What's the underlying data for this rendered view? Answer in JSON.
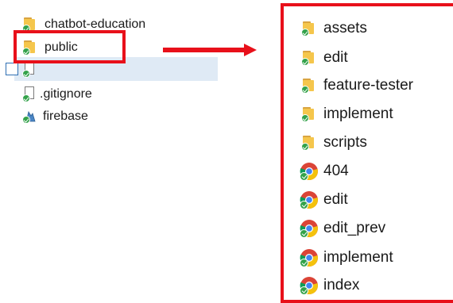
{
  "colors": {
    "highlight": "#e8101a",
    "selection": "#dfeaf5",
    "sync_ok": "#33a24a",
    "folder": "#f5c64c"
  },
  "left_tree": {
    "items": [
      {
        "label": "chatbot-education",
        "icon": "folder-synced-icon"
      },
      {
        "label": "public",
        "icon": "folder-synced-icon"
      },
      {
        "label": "",
        "icon": "file-synced-icon"
      },
      {
        "label": ".gitignore",
        "icon": "file-synced-icon"
      },
      {
        "label": "firebase",
        "icon": "firebase-synced-icon"
      }
    ]
  },
  "public_contents": {
    "items": [
      {
        "label": "assets",
        "icon": "folder-synced-icon"
      },
      {
        "label": "edit",
        "icon": "folder-synced-icon"
      },
      {
        "label": "feature-tester",
        "icon": "folder-synced-icon"
      },
      {
        "label": "implement",
        "icon": "folder-synced-icon"
      },
      {
        "label": "scripts",
        "icon": "folder-synced-icon"
      },
      {
        "label": "404",
        "icon": "chrome-html-synced-icon"
      },
      {
        "label": "edit",
        "icon": "chrome-html-synced-icon"
      },
      {
        "label": "edit_prev",
        "icon": "chrome-html-synced-icon"
      },
      {
        "label": "implement",
        "icon": "chrome-html-synced-icon"
      },
      {
        "label": "index",
        "icon": "chrome-html-synced-icon"
      }
    ]
  }
}
